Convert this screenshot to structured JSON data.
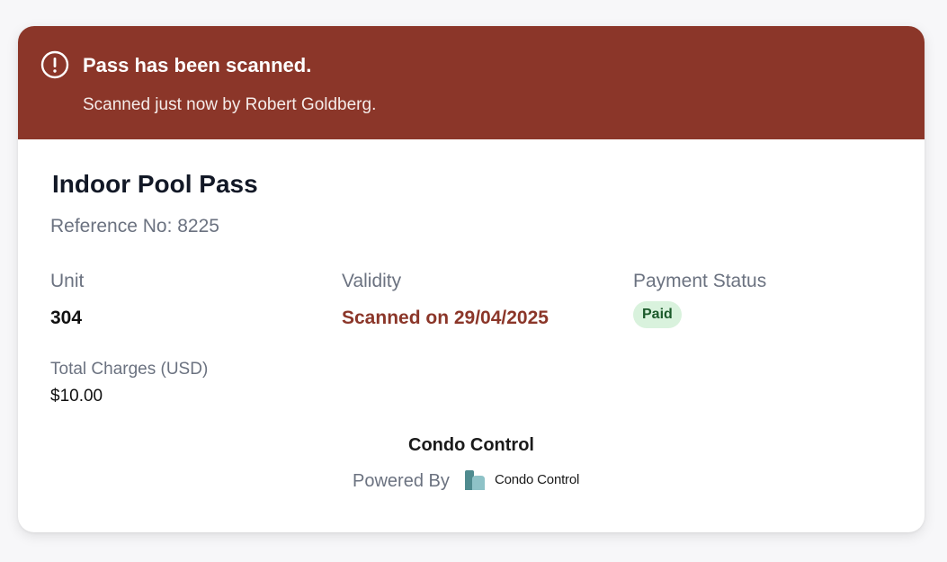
{
  "banner": {
    "icon": "exclamation-circle-icon",
    "title": "Pass has been scanned.",
    "subtitle": "Scanned just now by Robert Goldberg.",
    "color": "#8b3629"
  },
  "pass": {
    "title": "Indoor Pool Pass",
    "reference": "Reference No: 8225"
  },
  "fields": {
    "unit_label": "Unit",
    "unit_value": "304",
    "validity_label": "Validity",
    "validity_value": "Scanned on 29/04/2025",
    "payment_label": "Payment Status",
    "payment_value": "Paid",
    "charges_label": "Total Charges (USD)",
    "charges_value": "$10.00"
  },
  "footer": {
    "name": "Condo Control",
    "powered_by": "Powered By",
    "brand_logo_icon": "condo-control-logo-icon",
    "brand_text": "Condo Control"
  },
  "colors": {
    "accent": "#8b3629",
    "badge_bg": "#d9f2dd",
    "badge_text": "#1c5a2b"
  }
}
